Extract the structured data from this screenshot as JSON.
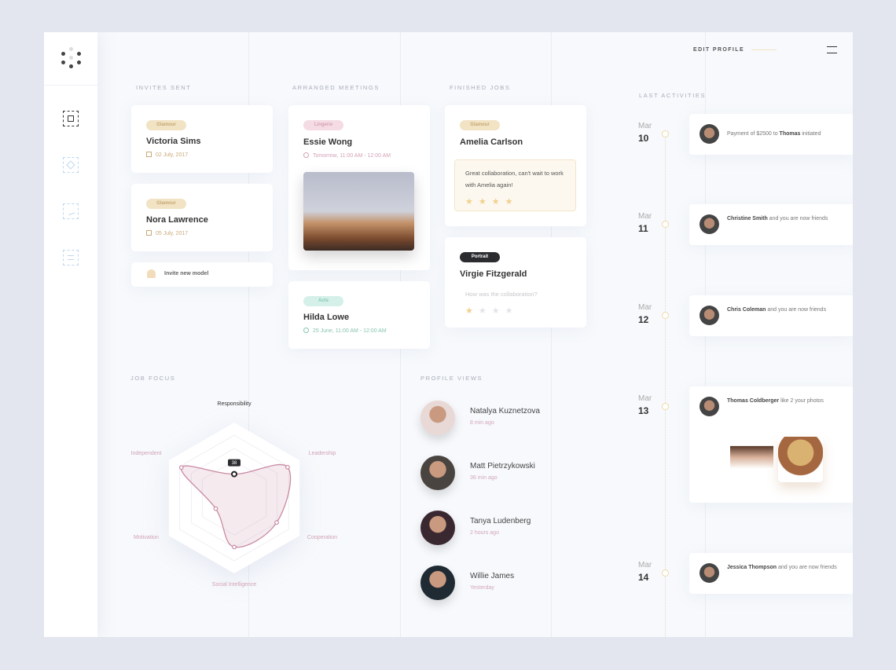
{
  "header": {
    "edit_profile": "EDIT PROFILE",
    "menu_icon": "hamburger-icon"
  },
  "sidebar": {
    "logo": "dots-logo",
    "items": [
      {
        "icon": "frame-square-icon",
        "active": true
      },
      {
        "icon": "frame-diamond-icon"
      },
      {
        "icon": "frame-chart-icon"
      },
      {
        "icon": "frame-sliders-icon"
      }
    ]
  },
  "colors": {
    "glamour": "#f1e3c4",
    "lingerie": "#f4dbe4",
    "acts": "#d4f0e8",
    "portrait": "#2b2c30",
    "star": "#f0d08c",
    "radar": "#c98aa3"
  },
  "invites": {
    "title": "INVITES SENT",
    "cards": [
      {
        "tag": "Glamour",
        "name": "Victoria Sims",
        "date": "02 July, 2017"
      },
      {
        "tag": "Glamour",
        "name": "Nora Lawrence",
        "date": "05 July, 2017"
      }
    ],
    "invite_label": "Invite new model"
  },
  "meetings": {
    "title": "ARRANGED MEETINGS",
    "cards": [
      {
        "tag": "Lingerie",
        "name": "Essie Wong",
        "time": "Tomorrow, 11:00 AM - 12:00 AM"
      },
      {
        "tag": "Acts",
        "name": "Hilda Lowe",
        "time": "25 June, 11:00 AM - 12:00 AM"
      }
    ]
  },
  "finished": {
    "title": "FINISHED JOBS",
    "cards": [
      {
        "tag": "Glamour",
        "name": "Amelia Carlson",
        "review": "Great collaboration, can't wait to work with Amelia again!",
        "rating": 4
      },
      {
        "tag": "Portrait",
        "name": "Virgie Fitzgerald",
        "prompt": "How was the collaboration?",
        "rating": 1
      }
    ]
  },
  "job_focus": {
    "title": "JOB FOCUS",
    "tooltip": "38"
  },
  "chart_data": {
    "type": "radar",
    "categories": [
      "Responsibility",
      "Leadership",
      "Cooperation",
      "Social Intelligence",
      "Motivation",
      "Independent"
    ],
    "values": [
      38,
      98,
      78,
      78,
      34,
      97
    ],
    "ylim": [
      0,
      100
    ],
    "highlighted": "Responsibility"
  },
  "profile_views": {
    "title": "PROFILE VIEWS",
    "items": [
      {
        "name": "Natalya Kuznetzova",
        "time": "8 min ago"
      },
      {
        "name": "Matt Pietrzykowski",
        "time": "36 min ago"
      },
      {
        "name": "Tanya Ludenberg",
        "time": "2 hours ago"
      },
      {
        "name": "Willie James",
        "time": "Yesterday"
      }
    ]
  },
  "activities": {
    "title": "LAST ACTIVITIES",
    "items": [
      {
        "month": "Mar",
        "day": "10",
        "pre": "Payment of $2500 to ",
        "bold": "Thomas",
        "post": " initiated"
      },
      {
        "month": "Mar",
        "day": "11",
        "bold": "Christine Smith",
        "post": " and you are now friends"
      },
      {
        "month": "Mar",
        "day": "12",
        "bold": "Chris Coleman",
        "post": " and you are now friends"
      },
      {
        "month": "Mar",
        "day": "13",
        "bold": "Thomas Coldberger",
        "post": " like 2 your photos"
      },
      {
        "month": "Mar",
        "day": "14",
        "bold": "Jessica Thompson",
        "post": " and you are now friends"
      }
    ]
  }
}
